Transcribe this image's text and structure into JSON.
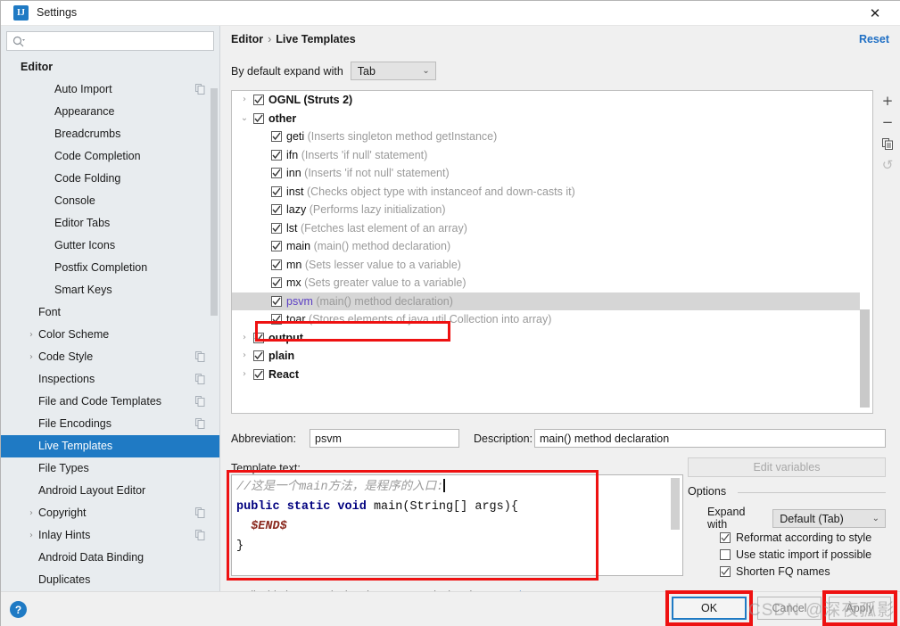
{
  "window": {
    "title": "Settings",
    "app_icon": "intellij-idea-icon",
    "close_icon": "close-icon"
  },
  "sidebar": {
    "search": {
      "placeholder": "",
      "value": "",
      "icon": "search-icon"
    },
    "items": [
      {
        "label": "Editor",
        "level": 0,
        "arrow": "",
        "copy": false,
        "selected": false
      },
      {
        "label": "Auto Import",
        "level": 2,
        "arrow": "",
        "copy": true,
        "selected": false
      },
      {
        "label": "Appearance",
        "level": 2,
        "arrow": "",
        "copy": false,
        "selected": false
      },
      {
        "label": "Breadcrumbs",
        "level": 2,
        "arrow": "",
        "copy": false,
        "selected": false
      },
      {
        "label": "Code Completion",
        "level": 2,
        "arrow": "",
        "copy": false,
        "selected": false
      },
      {
        "label": "Code Folding",
        "level": 2,
        "arrow": "",
        "copy": false,
        "selected": false
      },
      {
        "label": "Console",
        "level": 2,
        "arrow": "",
        "copy": false,
        "selected": false
      },
      {
        "label": "Editor Tabs",
        "level": 2,
        "arrow": "",
        "copy": false,
        "selected": false
      },
      {
        "label": "Gutter Icons",
        "level": 2,
        "arrow": "",
        "copy": false,
        "selected": false
      },
      {
        "label": "Postfix Completion",
        "level": 2,
        "arrow": "",
        "copy": false,
        "selected": false
      },
      {
        "label": "Smart Keys",
        "level": 2,
        "arrow": "",
        "copy": false,
        "selected": false
      },
      {
        "label": "Font",
        "level": 1,
        "arrow": "",
        "copy": false,
        "selected": false
      },
      {
        "label": "Color Scheme",
        "level": 1,
        "arrow": "›",
        "copy": false,
        "selected": false
      },
      {
        "label": "Code Style",
        "level": 1,
        "arrow": "›",
        "copy": true,
        "selected": false
      },
      {
        "label": "Inspections",
        "level": 1,
        "arrow": "",
        "copy": true,
        "selected": false
      },
      {
        "label": "File and Code Templates",
        "level": 1,
        "arrow": "",
        "copy": true,
        "selected": false
      },
      {
        "label": "File Encodings",
        "level": 1,
        "arrow": "",
        "copy": true,
        "selected": false
      },
      {
        "label": "Live Templates",
        "level": 1,
        "arrow": "",
        "copy": false,
        "selected": true
      },
      {
        "label": "File Types",
        "level": 1,
        "arrow": "",
        "copy": false,
        "selected": false
      },
      {
        "label": "Android Layout Editor",
        "level": 1,
        "arrow": "",
        "copy": false,
        "selected": false
      },
      {
        "label": "Copyright",
        "level": 1,
        "arrow": "›",
        "copy": true,
        "selected": false
      },
      {
        "label": "Inlay Hints",
        "level": 1,
        "arrow": "›",
        "copy": true,
        "selected": false
      },
      {
        "label": "Android Data Binding",
        "level": 1,
        "arrow": "",
        "copy": false,
        "selected": false
      },
      {
        "label": "Duplicates",
        "level": 1,
        "arrow": "",
        "copy": false,
        "selected": false
      }
    ]
  },
  "header": {
    "breadcrumb_root": "Editor",
    "breadcrumb_sep": "›",
    "breadcrumb_leaf": "Live Templates",
    "reset_label": "Reset"
  },
  "expand": {
    "label": "By default expand with",
    "value": "Tab",
    "chevron": "chevron-down-icon"
  },
  "templates": [
    {
      "type": "group",
      "arrow": "›",
      "checked": true,
      "name": "OGNL (Struts 2)",
      "desc": "",
      "highlight": false
    },
    {
      "type": "group",
      "arrow": "⌄",
      "checked": true,
      "name": "other",
      "desc": "",
      "highlight": false
    },
    {
      "type": "child",
      "arrow": "",
      "checked": true,
      "name": "geti",
      "desc": "(Inserts singleton method getInstance)",
      "highlight": false
    },
    {
      "type": "child",
      "arrow": "",
      "checked": true,
      "name": "ifn",
      "desc": "(Inserts 'if null' statement)",
      "highlight": false
    },
    {
      "type": "child",
      "arrow": "",
      "checked": true,
      "name": "inn",
      "desc": "(Inserts 'if not null' statement)",
      "highlight": false
    },
    {
      "type": "child",
      "arrow": "",
      "checked": true,
      "name": "inst",
      "desc": "(Checks object type with instanceof and down-casts it)",
      "highlight": false
    },
    {
      "type": "child",
      "arrow": "",
      "checked": true,
      "name": "lazy",
      "desc": "(Performs lazy initialization)",
      "highlight": false
    },
    {
      "type": "child",
      "arrow": "",
      "checked": true,
      "name": "lst",
      "desc": "(Fetches last element of an array)",
      "highlight": false
    },
    {
      "type": "child",
      "arrow": "",
      "checked": true,
      "name": "main",
      "desc": "(main() method declaration)",
      "highlight": false
    },
    {
      "type": "child",
      "arrow": "",
      "checked": true,
      "name": "mn",
      "desc": "(Sets lesser value to a variable)",
      "highlight": false
    },
    {
      "type": "child",
      "arrow": "",
      "checked": true,
      "name": "mx",
      "desc": "(Sets greater value to a variable)",
      "highlight": false
    },
    {
      "type": "child",
      "arrow": "",
      "checked": true,
      "name": "psvm",
      "desc": "(main() method declaration)",
      "highlight": true,
      "accent": true
    },
    {
      "type": "child",
      "arrow": "",
      "checked": true,
      "name": "toar",
      "desc": "(Stores elements of java.util.Collection into array)",
      "highlight": false
    },
    {
      "type": "group",
      "arrow": "›",
      "checked": true,
      "name": "output",
      "desc": "",
      "highlight": false
    },
    {
      "type": "group",
      "arrow": "›",
      "checked": true,
      "name": "plain",
      "desc": "",
      "highlight": false
    },
    {
      "type": "group",
      "arrow": "›",
      "checked": true,
      "name": "React",
      "desc": "",
      "highlight": false
    }
  ],
  "list_toolbar": [
    {
      "icon": "plus-icon",
      "glyph": "+",
      "disabled": false
    },
    {
      "icon": "minus-icon",
      "glyph": "−",
      "disabled": false
    },
    {
      "icon": "copy-icon",
      "glyph": "",
      "disabled": false
    },
    {
      "icon": "undo-icon",
      "glyph": "↺",
      "disabled": true
    }
  ],
  "fields": {
    "abbreviation_label": "Abbreviation:",
    "abbreviation_value": "psvm",
    "description_label": "Description:",
    "description_value": "main() method declaration",
    "template_text_label": "Template text:"
  },
  "editor": {
    "line1_comment": "//这是一个main方法，是程序的入口:",
    "line2_kw": "public static void ",
    "line2_rest": "main(String[] args){",
    "line3_var": "$END$",
    "line4": "}"
  },
  "options": {
    "edit_variables_label": "Edit variables",
    "group_title": "Options",
    "expand_with_label": "Expand with",
    "expand_with_value": "Default (Tab)",
    "checkboxes": [
      {
        "label": "Reformat according to style",
        "checked": true
      },
      {
        "label": "Use static import if possible",
        "checked": false
      },
      {
        "label": "Shorten FQ names",
        "checked": true
      }
    ]
  },
  "applicable": {
    "text": "Applicable in Java: declaration; Groovy: declaration.",
    "change_label": "Change",
    "change_chevron": "chevron-down-icon"
  },
  "bottom": {
    "help_label": "?",
    "ok_label": "OK",
    "cancel_label": "Cancel",
    "apply_label": "Apply",
    "watermark": "CSDN @深夜孤影"
  },
  "colors": {
    "accent_blue": "#1f7ac4",
    "link_blue": "#1f6fc4",
    "annotation_red": "#ee1111",
    "template_accent": "#5c3fc4"
  }
}
